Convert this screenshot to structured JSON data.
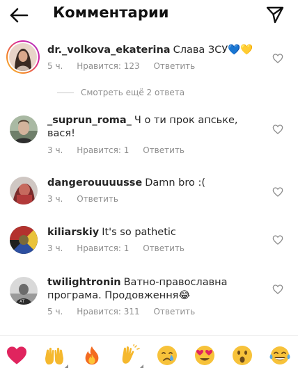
{
  "header": {
    "title": "Комментарии",
    "back_icon": "arrow-left-icon",
    "send_icon": "paper-plane-icon"
  },
  "comments": [
    {
      "username": "dr._volkova_ekaterina",
      "text": "Слава ЗСУ💙💛",
      "time": "5 ч.",
      "likes": "Нравится: 123",
      "reply": "Ответить",
      "has_story": true
    },
    {
      "username": "_suprun_roma_",
      "text": "Ч  о ти прок    апське, вася!",
      "time": "3 ч.",
      "likes": "Нравится: 1",
      "reply": "Ответить",
      "has_story": false
    },
    {
      "username": "dangerouuuusse",
      "text": "Damn bro :(",
      "time": "3 ч.",
      "reply": "Ответить",
      "has_story": false
    },
    {
      "username": "kiliarskiy",
      "text": "It's so pathetic",
      "time": "3 ч.",
      "likes": "Нравится: 1",
      "reply": "Ответить",
      "has_story": false
    },
    {
      "username": "twilightronin",
      "text": "Ватно-православна програма. Продовження😂",
      "time": "5 ч.",
      "likes": "Нравится: 311",
      "reply": "Ответить",
      "has_story": false
    }
  ],
  "more_replies": "Смотреть ещё 2 ответа",
  "emoji_bar": [
    "❤️",
    "🙌",
    "🔥",
    "👏",
    "😢",
    "😍",
    "😮",
    "😂"
  ],
  "colors": {
    "text": "#262626",
    "meta": "#8e8e8e",
    "heart_outline": "#8e8e8e",
    "story_ring_start": "#f9c43a",
    "story_ring_end": "#a537c4"
  }
}
